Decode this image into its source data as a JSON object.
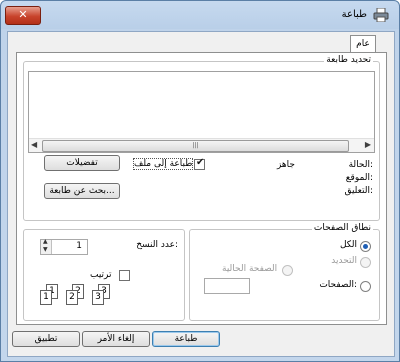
{
  "window": {
    "title": "طباعة",
    "close_label": "✕"
  },
  "tabs": [
    {
      "label": "عام"
    }
  ],
  "select_printer": {
    "group_label": "تحديد طابعة",
    "status_label": "الحالة:",
    "status_value": "جاهز",
    "location_label": "الموقع:",
    "comment_label": "التعليق:",
    "print_to_file_label": "طباعة إلى ملف",
    "print_to_file_checked": true,
    "preferences_button": "تفضيلات",
    "find_printer_button": "بحث عن طابعة..."
  },
  "page_range": {
    "group_label": "نطاق الصفحات",
    "options": [
      {
        "label": "الكل",
        "selected": true,
        "enabled": true
      },
      {
        "label": "التحديد",
        "selected": false,
        "enabled": false
      },
      {
        "label": "الصفحة الحالية",
        "selected": false,
        "enabled": false
      },
      {
        "label": "الصفحات:",
        "selected": false,
        "enabled": true
      }
    ],
    "pages_value": ""
  },
  "copies": {
    "label": "عدد النسخ:",
    "value": "1",
    "collate_label": "ترتيب",
    "collate_checked": false,
    "collate_pages": [
      "1",
      "1",
      "2",
      "2",
      "3",
      "3"
    ]
  },
  "buttons": {
    "print": "طباعة",
    "cancel": "إلغاء الأمر",
    "apply": "تطبيق"
  }
}
